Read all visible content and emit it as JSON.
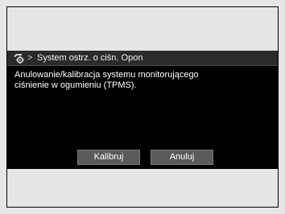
{
  "header": {
    "icon": "gear-car-icon",
    "breadcrumb_separator": ">",
    "title": "System ostrz. o ciśn. Opon"
  },
  "message": {
    "line1": "Anulowanie/kalibracja systemu monitorującego",
    "line2": "ciśnienie w ogumieniu (TPMS)."
  },
  "buttons": {
    "calibrate_label": "Kalibruj",
    "cancel_label": "Anuluj"
  },
  "colors": {
    "screen_background": "#000000",
    "button_background": "#5a5a5a",
    "text": "#ffffff"
  }
}
